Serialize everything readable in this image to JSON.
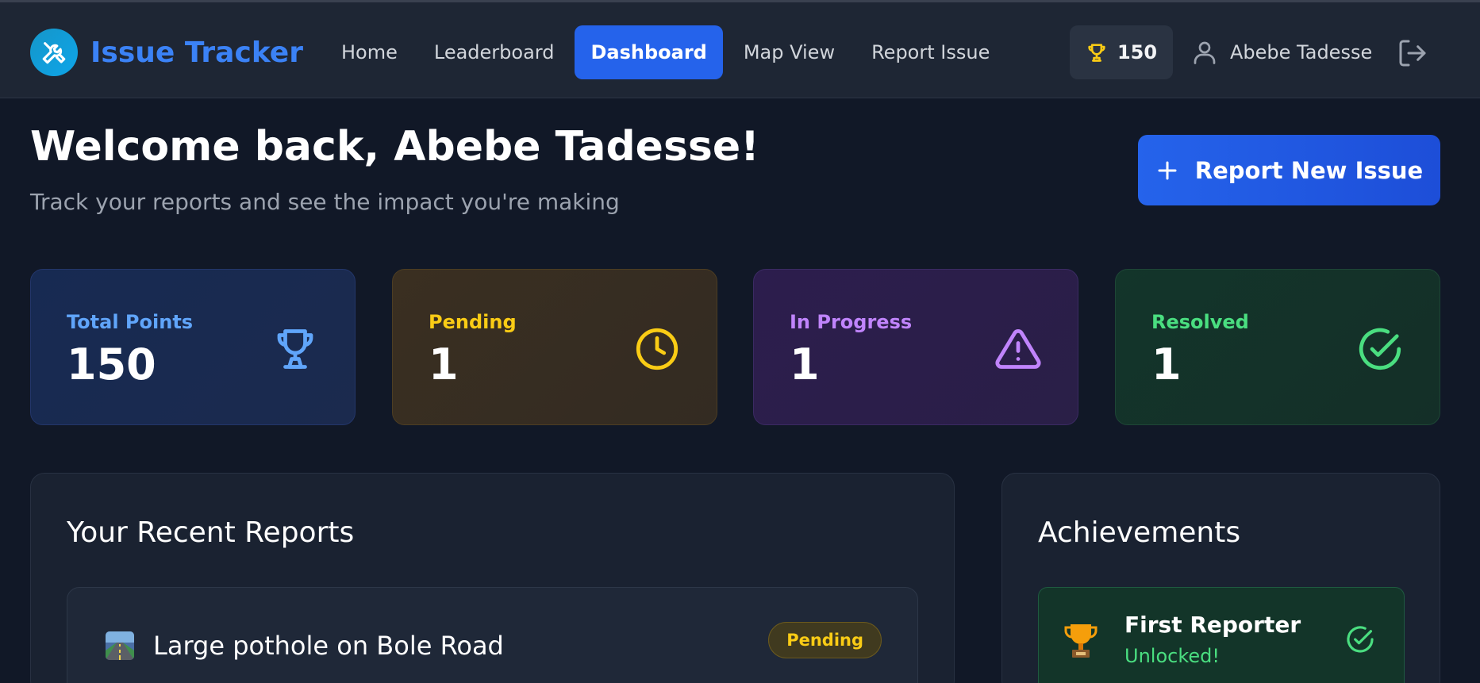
{
  "brand": {
    "title": "Issue Tracker",
    "logo_icon": "tools-icon",
    "accent": "#3b82f6"
  },
  "nav": {
    "items": [
      {
        "label": "Home",
        "active": false
      },
      {
        "label": "Leaderboard",
        "active": false
      },
      {
        "label": "Dashboard",
        "active": true
      },
      {
        "label": "Map View",
        "active": false
      },
      {
        "label": "Report Issue",
        "active": false
      }
    ]
  },
  "header": {
    "points": "150",
    "points_icon": "trophy-icon",
    "user_name": "Abebe Tadesse",
    "user_icon": "user-icon",
    "logout_icon": "logout-icon"
  },
  "welcome": {
    "title": "Welcome back, Abebe Tadesse!",
    "subtitle": "Track your reports and see the impact you're making",
    "cta_label": "Report New Issue"
  },
  "stats": [
    {
      "label": "Total Points",
      "value": "150",
      "icon": "trophy-icon",
      "color": "#60a5fa"
    },
    {
      "label": "Pending",
      "value": "1",
      "icon": "clock-icon",
      "color": "#facc15"
    },
    {
      "label": "In Progress",
      "value": "1",
      "icon": "alert-triangle-icon",
      "color": "#c084fc"
    },
    {
      "label": "Resolved",
      "value": "1",
      "icon": "check-circle-icon",
      "color": "#4ade80"
    }
  ],
  "recent_reports": {
    "title": "Your Recent Reports",
    "items": [
      {
        "title": "Large pothole on Bole Road",
        "status": "Pending",
        "icon": "road-icon"
      }
    ]
  },
  "achievements": {
    "title": "Achievements",
    "items": [
      {
        "name": "First Reporter",
        "status": "Unlocked!",
        "icon": "trophy-icon"
      }
    ]
  }
}
